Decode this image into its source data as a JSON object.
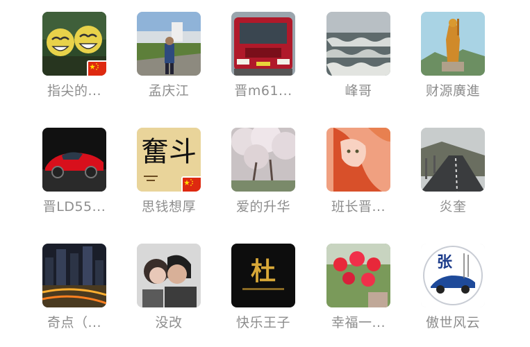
{
  "contacts": [
    {
      "name": "指尖的...",
      "picture": "smiley-faces",
      "badge": "china-flag"
    },
    {
      "name": "孟庆江",
      "picture": "man-on-road"
    },
    {
      "name": "晋m61...",
      "picture": "red-truck"
    },
    {
      "name": "峰哥",
      "picture": "sea-waves"
    },
    {
      "name": "财源廣進",
      "picture": "golden-statue"
    },
    {
      "name": "晋LD55...",
      "picture": "red-sports-car"
    },
    {
      "name": "思钱想厚",
      "picture": "calligraphy-fendou",
      "badge": "china-flag",
      "calligraphy": "奮斗"
    },
    {
      "name": "爱的升华",
      "picture": "cherry-blossoms"
    },
    {
      "name": "班长晋...",
      "picture": "anime-girl"
    },
    {
      "name": "炎奎",
      "picture": "mountain-road"
    },
    {
      "name": "奇点（...",
      "picture": "city-night"
    },
    {
      "name": "没改",
      "picture": "couple"
    },
    {
      "name": "快乐王子",
      "picture": "gold-character-du",
      "calligraphy": "杜"
    },
    {
      "name": "幸福一...",
      "picture": "red-roses"
    },
    {
      "name": "傲世风云",
      "picture": "blue-car-zhang-logo",
      "calligraphy": "张"
    }
  ]
}
